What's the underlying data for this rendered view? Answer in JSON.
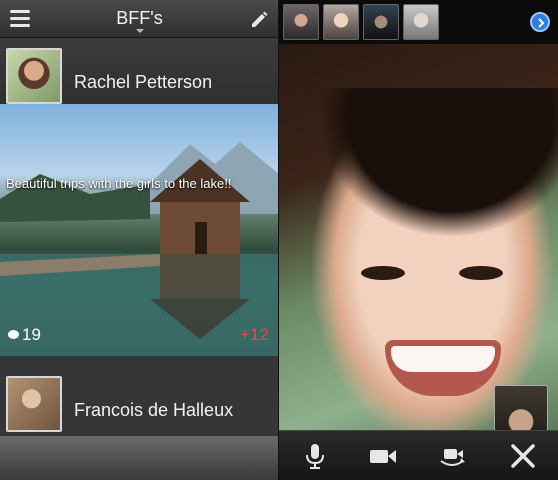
{
  "left": {
    "header": {
      "title": "BFF's",
      "menu_icon": "hamburger-menu-icon",
      "edit_icon": "pencil-icon"
    },
    "feed": [
      {
        "name": "Rachel Petterson",
        "caption": "Beautiful trips with the girls to the lake!!",
        "comments": "19",
        "plus": "+12",
        "comment_icon": "speech-bubble-icon"
      },
      {
        "name": "Francois de Halleux"
      }
    ]
  },
  "right": {
    "thumbnails": [
      "contact-1",
      "contact-2",
      "contact-3",
      "contact-4"
    ],
    "next_icon": "chevron-right-icon",
    "controls": [
      "microphone-icon",
      "video-camera-icon",
      "switch-camera-icon",
      "end-call-icon"
    ]
  },
  "colors": {
    "accent_red": "#e8493f",
    "accent_blue": "#2f7de1"
  }
}
